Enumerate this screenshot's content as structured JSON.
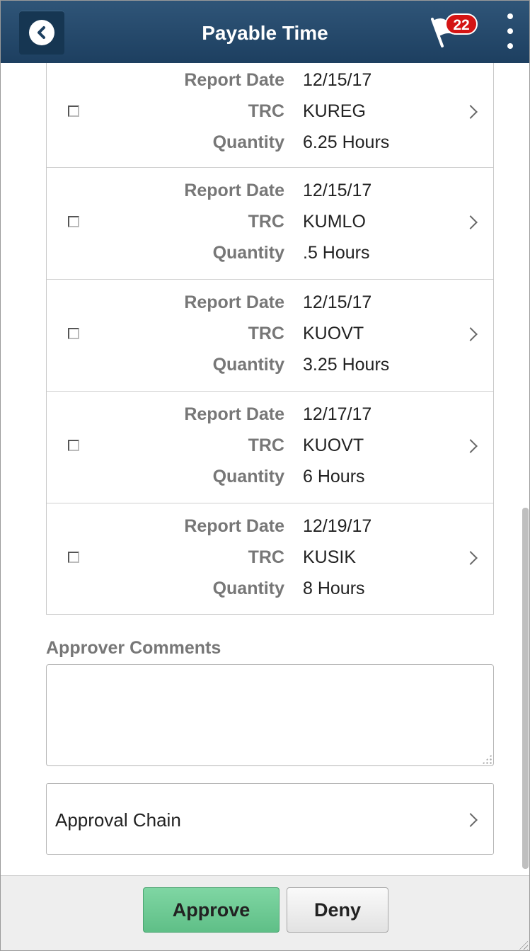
{
  "header": {
    "title": "Payable Time",
    "notification_count": "22",
    "back_icon": "chevron-left-icon",
    "flag_icon": "flag-icon",
    "menu_icon": "more-vertical-icon"
  },
  "field_labels": {
    "report_date": "Report Date",
    "trc": "TRC",
    "quantity": "Quantity"
  },
  "rows": [
    {
      "report_date": "12/15/17",
      "trc": "KUREG",
      "quantity": "6.25 Hours",
      "checked": false
    },
    {
      "report_date": "12/15/17",
      "trc": "KUMLO",
      "quantity": ".5 Hours",
      "checked": false
    },
    {
      "report_date": "12/15/17",
      "trc": "KUOVT",
      "quantity": "3.25 Hours",
      "checked": false
    },
    {
      "report_date": "12/17/17",
      "trc": "KUOVT",
      "quantity": "6 Hours",
      "checked": false
    },
    {
      "report_date": "12/19/17",
      "trc": "KUSIK",
      "quantity": "8 Hours",
      "checked": false
    }
  ],
  "comments": {
    "label": "Approver Comments",
    "value": ""
  },
  "approval_chain": {
    "label": "Approval Chain"
  },
  "footer": {
    "approve_label": "Approve",
    "deny_label": "Deny"
  },
  "colors": {
    "header_bg": "#1d3f60",
    "approve_bg": "#6cc994",
    "badge_bg": "#d41414"
  }
}
